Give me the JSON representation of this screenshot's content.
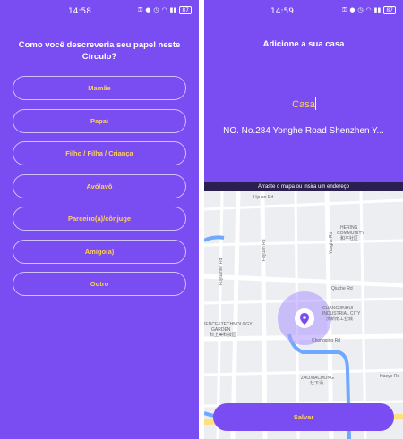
{
  "left": {
    "status": {
      "time": "14:58",
      "battery": "87"
    },
    "question": "Como você descreveria seu papel neste Círculo?",
    "options": [
      "Mamãe",
      "Papai",
      "Filho / Filha / Criança",
      "Avó/avô",
      "Parceiro(a)/cônjuge",
      "Amigo(a)",
      "Outro"
    ]
  },
  "right": {
    "status": {
      "time": "14:59",
      "battery": "87"
    },
    "title": "Adicione a sua casa",
    "place_name": "Casa",
    "address": "NO. No.284 Yonghe Road Shenzhen Y...",
    "map_hint": "Arraste o mapa ou insira um endereço",
    "save_label": "Salvar",
    "map_labels": {
      "uyuan": "Uyuan Rd",
      "hering1": "HERING",
      "hering2": "COMMUNITY",
      "hering3": "和平社区",
      "fuyuan": "Fuyuan Rd",
      "fuyuanter": "Fuyuanter Rd",
      "yonghe": "Yonghe Rd",
      "qiuche": "Qiuche Rd",
      "guangjin1": "GUANGJINHUI",
      "guangjin2": "INDUSTRIAL CITY",
      "guangjin3": "洗新南工业城",
      "science1": "IENCE&TECHNOLOGY",
      "science2": "GARDEN",
      "science3": "科上美科技园",
      "chongqing": "Chongqing Rd",
      "zaoxiachong1": "ZAOXIACHONG",
      "zaoxiachong2": "灶下涌",
      "haoye": "Haoye Rd"
    },
    "colors": {
      "accent": "#7a4df2",
      "option_text": "#ffd25a"
    }
  }
}
